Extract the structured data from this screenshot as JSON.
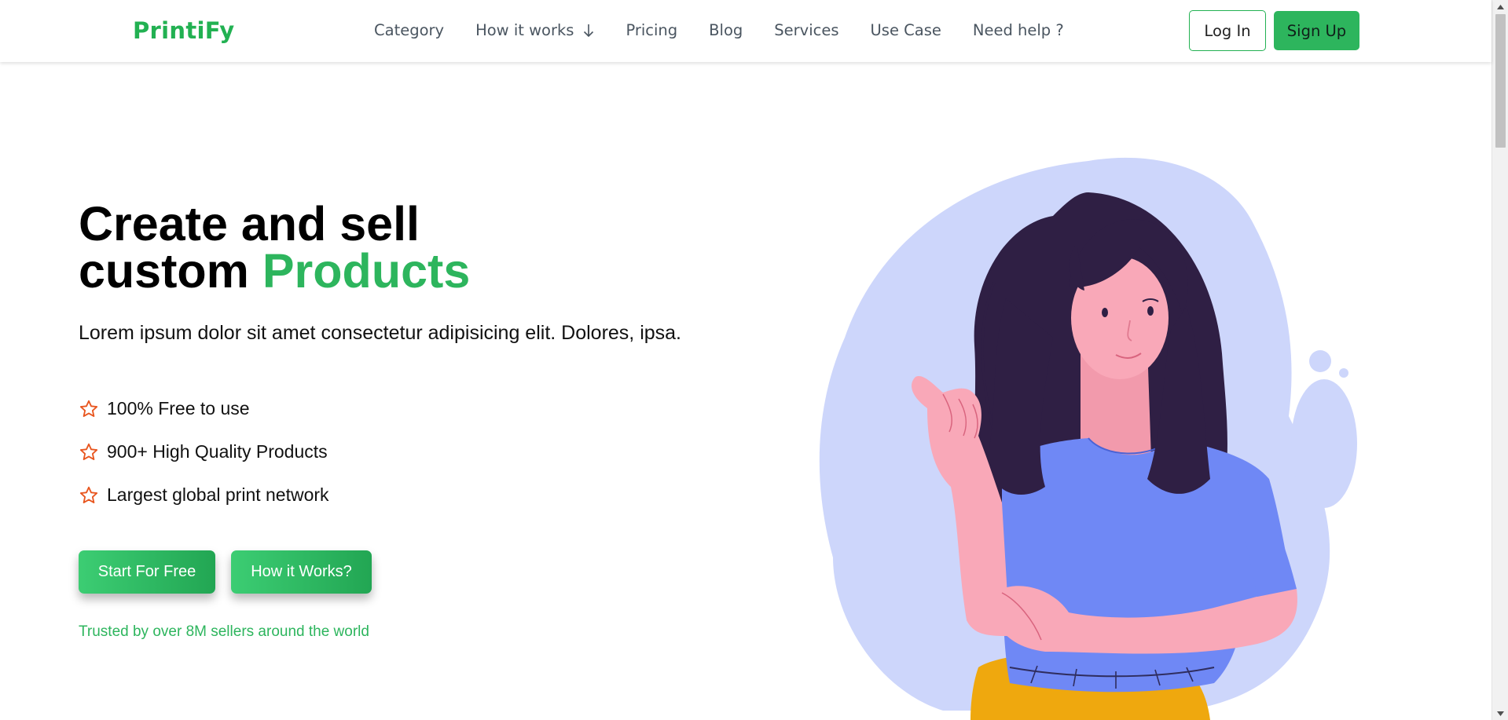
{
  "header": {
    "logo": "PrintiFy",
    "nav": [
      {
        "label": "Category"
      },
      {
        "label": "How it works",
        "has_dropdown": true
      },
      {
        "label": "Pricing"
      },
      {
        "label": "Blog"
      },
      {
        "label": "Services"
      },
      {
        "label": "Use Case"
      },
      {
        "label": "Need help ?"
      }
    ],
    "login_label": "Log In",
    "signup_label": "Sign Up"
  },
  "hero": {
    "title_line1": "Create and sell",
    "title_line2_prefix": "custom ",
    "title_line2_accent": "Products",
    "subtitle": "Lorem ipsum dolor sit amet consectetur adipisicing elit. Dolores, ipsa.",
    "features": [
      {
        "text": "100% Free to use",
        "icon": "star-outline-icon"
      },
      {
        "text": "900+ High Quality Products",
        "icon": "star-outline-icon"
      },
      {
        "text": "Largest global print network",
        "icon": "star-outline-icon"
      }
    ],
    "cta_primary": "Start For Free",
    "cta_secondary": "How it Works?",
    "trusted": "Trusted by over 8M sellers around the world"
  },
  "colors": {
    "brand_green": "#2db55d",
    "star_orange": "#e8561f",
    "blob": "#cdd6fb",
    "shirt": "#6f88f5",
    "hair": "#2f1f44",
    "skin": "#f9a8b8",
    "skirt": "#efa80e"
  },
  "illustration": {
    "icon": "woman-pointing-illustration"
  }
}
